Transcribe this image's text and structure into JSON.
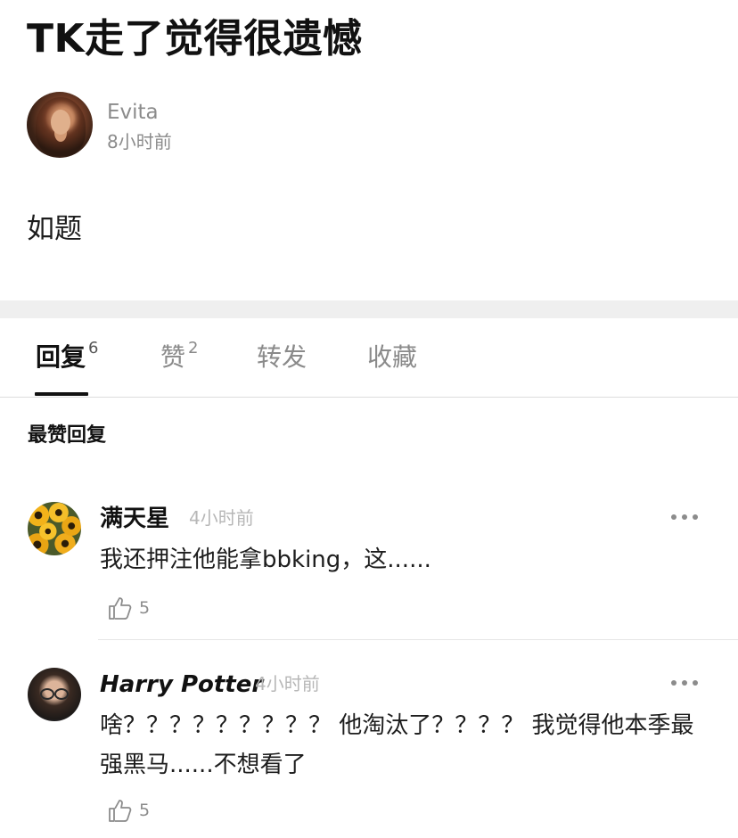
{
  "post": {
    "title": "TK走了觉得很遗憾",
    "author": "Evita",
    "time": "8小时前",
    "body": "如题"
  },
  "tabs": [
    {
      "label": "回复",
      "count": "6",
      "active": true
    },
    {
      "label": "赞",
      "count": "2",
      "active": false
    },
    {
      "label": "转发",
      "count": "",
      "active": false
    },
    {
      "label": "收藏",
      "count": "",
      "active": false
    }
  ],
  "section_heading": "最赞回复",
  "replies": [
    {
      "name": "满天星",
      "time": "4小时前",
      "text": "我还押注他能拿bbking，这......",
      "likes": "5",
      "avatar_icon": "flower-avatar"
    },
    {
      "name": "Harry Potter",
      "time": "4小时前",
      "text": "啥？？？？？？？？？ 他淘汰了？？？？ 我觉得他本季最强黑马......不想看了",
      "likes": "5",
      "avatar_icon": "harry-potter-avatar"
    }
  ],
  "colors": {
    "text_primary": "#111111",
    "text_secondary": "#8b8b8b",
    "divider": "#e6e6e6",
    "section_gap": "#efefef"
  }
}
